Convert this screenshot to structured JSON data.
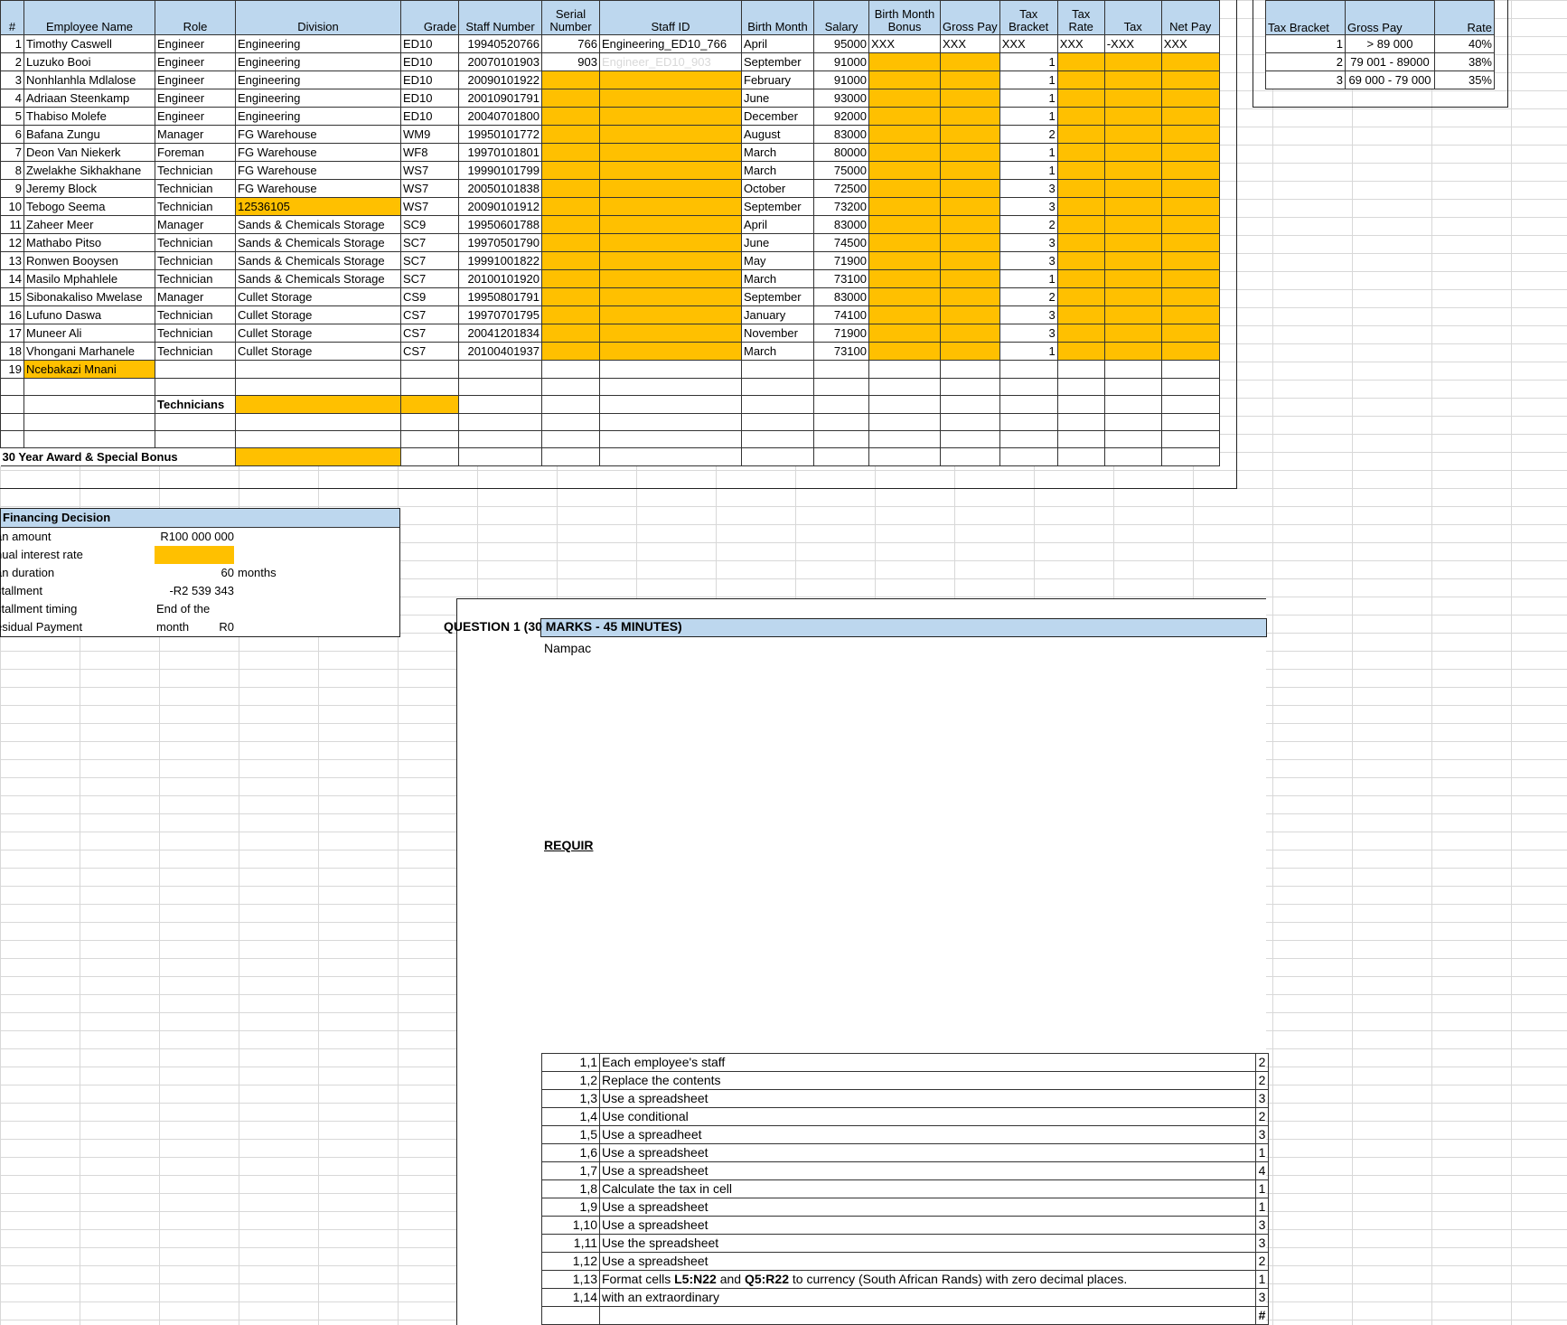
{
  "employees": {
    "headers": {
      "num": "#",
      "name": "Employee Name",
      "role": "Role",
      "division": "Division",
      "grade": "Grade",
      "staff_number": "Staff Number",
      "serial_number": "Serial Number",
      "staff_id": "Staff ID",
      "birth_month": "Birth Month",
      "salary": "Salary",
      "bm_bonus": "Birth Month Bonus",
      "gross_pay": "Gross Pay",
      "tax_bracket": "Tax Bracket",
      "tax_rate": "Tax Rate",
      "tax": "Tax",
      "net_pay": "Net Pay"
    },
    "rows": [
      {
        "num": "1",
        "name": "Timothy Caswell",
        "role": "Engineer",
        "division": "Engineering",
        "grade": "ED10",
        "staff_number": "19940520766",
        "serial": "766",
        "staff_id": "Engineering_ED10_766",
        "birth_month": "April",
        "salary": "95000",
        "bonus": "XXX",
        "gross": "XXX",
        "bracket": "XXX",
        "rate": "XXX",
        "tax": "-XXX",
        "net": "XXX"
      },
      {
        "num": "2",
        "name": "Luzuko Booi",
        "role": "Engineer",
        "division": "Engineering",
        "grade": "ED10",
        "staff_number": "20070101903",
        "serial": "903",
        "staff_id": "Engineer_ED10_903",
        "birth_month": "September",
        "salary": "91000",
        "bracket": "1"
      },
      {
        "num": "3",
        "name": "Nonhlanhla Mdlalose",
        "role": "Engineer",
        "division": "Engineering",
        "grade": "ED10",
        "staff_number": "20090101922",
        "birth_month": "February",
        "salary": "91000",
        "bracket": "1"
      },
      {
        "num": "4",
        "name": "Adriaan Steenkamp",
        "role": "Engineer",
        "division": "Engineering",
        "grade": "ED10",
        "staff_number": "20010901791",
        "birth_month": "June",
        "salary": "93000",
        "bracket": "1"
      },
      {
        "num": "5",
        "name": "Thabiso Molefe",
        "role": "Engineer",
        "division": "Engineering",
        "grade": "ED10",
        "staff_number": "20040701800",
        "birth_month": "December",
        "salary": "92000",
        "bracket": "1"
      },
      {
        "num": "6",
        "name": "Bafana Zungu",
        "role": "Manager",
        "division": "FG Warehouse",
        "grade": "WM9",
        "staff_number": "19950101772",
        "birth_month": "August",
        "salary": "83000",
        "bracket": "2"
      },
      {
        "num": "7",
        "name": "Deon Van Niekerk",
        "role": "Foreman",
        "division": "FG Warehouse",
        "grade": "WF8",
        "staff_number": "19970101801",
        "birth_month": "March",
        "salary": "80000",
        "bracket": "1"
      },
      {
        "num": "8",
        "name": "Zwelakhe Sikhakhane",
        "role": "Technician",
        "division": "FG Warehouse",
        "grade": "WS7",
        "staff_number": "19990101799",
        "birth_month": "March",
        "salary": "75000",
        "bracket": "1"
      },
      {
        "num": "9",
        "name": "Jeremy Block",
        "role": "Technician",
        "division": "FG Warehouse",
        "grade": "WS7",
        "staff_number": "20050101838",
        "birth_month": "October",
        "salary": "72500",
        "bracket": "3"
      },
      {
        "num": "10",
        "name": "Tebogo Seema",
        "role": "Technician",
        "division": "12536105",
        "division_highlight": true,
        "grade": "WS7",
        "staff_number": "20090101912",
        "birth_month": "September",
        "salary": "73200",
        "bracket": "3"
      },
      {
        "num": "11",
        "name": "Zaheer Meer",
        "role": "Manager",
        "division": "Sands & Chemicals Storage",
        "grade": "SC9",
        "staff_number": "19950601788",
        "birth_month": "April",
        "salary": "83000",
        "bracket": "2"
      },
      {
        "num": "12",
        "name": "Mathabo Pitso",
        "role": "Technician",
        "division": "Sands & Chemicals Storage",
        "grade": "SC7",
        "staff_number": "19970501790",
        "birth_month": "June",
        "salary": "74500",
        "bracket": "3"
      },
      {
        "num": "13",
        "name": "Ronwen Booysen",
        "role": "Technician",
        "division": "Sands & Chemicals Storage",
        "grade": "SC7",
        "staff_number": "19991001822",
        "birth_month": "May",
        "salary": "71900",
        "bracket": "3"
      },
      {
        "num": "14",
        "name": "Masilo Mphahlele",
        "role": "Technician",
        "division": "Sands & Chemicals Storage",
        "grade": "SC7",
        "staff_number": "20100101920",
        "birth_month": "March",
        "salary": "73100",
        "bracket": "1"
      },
      {
        "num": "15",
        "name": "Sibonakaliso Mwelase",
        "role": "Manager",
        "division": "Cullet Storage",
        "grade": "CS9",
        "staff_number": "19950801791",
        "birth_month": "September",
        "salary": "83000",
        "bracket": "2"
      },
      {
        "num": "16",
        "name": "Lufuno Daswa",
        "role": "Technician",
        "division": "Cullet Storage",
        "grade": "CS7",
        "staff_number": "19970701795",
        "birth_month": "January",
        "salary": "74100",
        "bracket": "3"
      },
      {
        "num": "17",
        "name": "Muneer Ali",
        "role": "Technician",
        "division": "Cullet Storage",
        "grade": "CS7",
        "staff_number": "20041201834",
        "birth_month": "November",
        "salary": "71900",
        "bracket": "3"
      },
      {
        "num": "18",
        "name": "Vhongani Marhanele",
        "role": "Technician",
        "division": "Cullet Storage",
        "grade": "CS7",
        "staff_number": "20100401937",
        "birth_month": "March",
        "salary": "73100",
        "bracket": "1"
      }
    ],
    "new_row": {
      "num": "19",
      "name": "Ncebakazi Mnani"
    },
    "technicians_label": "Technicians",
    "award_label": "30 Year Award & Special Bonus"
  },
  "tax_table": {
    "headers": {
      "bracket": "Tax Bracket",
      "gross": "Gross Pay",
      "rate": "Rate"
    },
    "rows": [
      {
        "bracket": "1",
        "gross": "> 89 000",
        "rate": "40%"
      },
      {
        "bracket": "2",
        "gross": "79 001 - 89000",
        "rate": "38%"
      },
      {
        "bracket": "3",
        "gross": "69 000 - 79 000",
        "rate": "35%"
      }
    ]
  },
  "financing": {
    "title": "Financing Decision",
    "loan_amount_label": "an amount",
    "loan_amount": "R100 000 000",
    "interest_label": "nual interest rate",
    "duration_label": "an duration",
    "duration": "60",
    "duration_unit": "months",
    "installment_label": "stallment",
    "installment": "-R2 539 343",
    "timing_label": "stallment timing",
    "timing": "End of the month",
    "residual_label": "esidual Payment",
    "residual": "R0"
  },
  "question": {
    "title": "QUESTION 1 (30 MARKS - 45 MINUTES)",
    "company": "Nampac",
    "required_label": "REQUIR",
    "items": [
      {
        "no": "1,1",
        "text": "Each employee's staff",
        "marks": "2"
      },
      {
        "no": "1,2",
        "text": "Replace the contents",
        "marks": "2"
      },
      {
        "no": "1,3",
        "text": "Use a spreadsheet",
        "marks": "3"
      },
      {
        "no": "1,4",
        "text": "Use conditional",
        "marks": "2"
      },
      {
        "no": "1,5",
        "text": "Use a spreadheet",
        "marks": "3"
      },
      {
        "no": "1,6",
        "text": "Use a spreadsheet",
        "marks": "1"
      },
      {
        "no": "1,7",
        "text": "Use a spreadsheet",
        "marks": "4"
      },
      {
        "no": "1,8",
        "text": "Calculate the tax in cell",
        "marks": "1"
      },
      {
        "no": "1,9",
        "text": "Use a spreadsheet",
        "marks": "1"
      },
      {
        "no": "1,10",
        "text": "Use a spreadsheet",
        "marks": "3"
      },
      {
        "no": "1,11",
        "text": "Use the spreadsheet",
        "marks": "3"
      },
      {
        "no": "1,12",
        "text": "Use a spreadsheet",
        "marks": "2"
      },
      {
        "no": "1,13",
        "text_pre": "Format cells ",
        "text_b1": "L5:N22",
        "text_mid": " and ",
        "text_b2": "Q5:R22",
        "text_post": " to currency (South African Rands) with zero decimal places.",
        "marks": "1"
      },
      {
        "no": "1,14",
        "text": "with an extraordinary",
        "marks": "3"
      }
    ],
    "total_marks": "#"
  }
}
